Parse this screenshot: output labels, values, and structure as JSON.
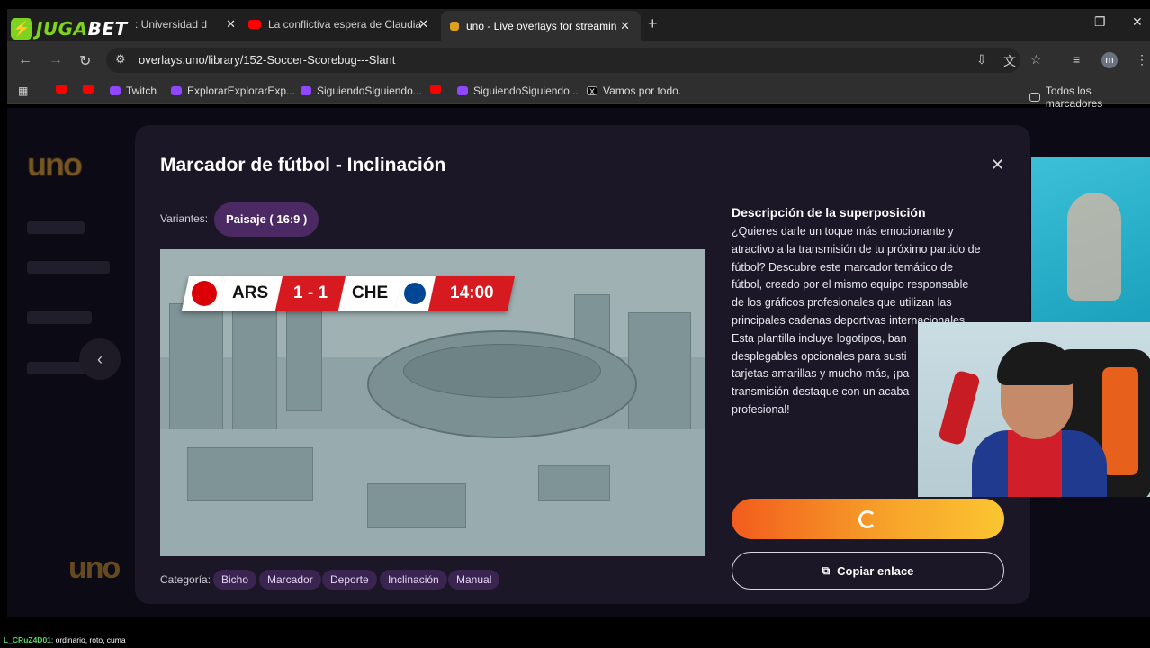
{
  "browser": {
    "logo": {
      "left": "JUGA",
      "right": "BET"
    },
    "tabs": [
      {
        "label": ": Universidad d",
        "icon": "tab-favicon"
      },
      {
        "label": "La conflictiva espera de Claudia",
        "icon": "youtube-icon"
      },
      {
        "label": "uno - Live overlays for streamin",
        "icon": "uno-icon",
        "active": true
      }
    ],
    "url": "overlays.uno/library/152-Soccer-Scorebug---Slant",
    "profile_initial": "m",
    "bookmarks": [
      {
        "label": "",
        "icon": "youtube-icon"
      },
      {
        "label": "",
        "icon": "youtube-icon"
      },
      {
        "label": "Twitch",
        "icon": "twitch-icon"
      },
      {
        "label": "ExplorarExplorarExp...",
        "icon": "twitch-icon"
      },
      {
        "label": "SiguiendoSiguiendo...",
        "icon": "twitch-icon"
      },
      {
        "label": "",
        "icon": "youtube-icon"
      },
      {
        "label": "SiguiendoSiguiendo...",
        "icon": "twitch-icon"
      },
      {
        "label": "Vamos por todo.",
        "icon": "x-icon"
      }
    ],
    "all_bookmarks": "Todos los marcadores"
  },
  "modal": {
    "title": "Marcador de fútbol - Inclinación",
    "variants_label": "Variantes:",
    "variant": "Paisaje ( 16:9 )",
    "scorebug": {
      "home": "ARS",
      "score": "1 - 1",
      "away": "CHE",
      "time": "14:00"
    },
    "description_title": "Descripción de la superposición",
    "description_lines": [
      "¿Quieres darle un toque más emocionante y",
      "atractivo a la transmisión de tu próximo partido de",
      "fútbol? Descubre este marcador temático de",
      "fútbol, creado por el mismo equipo responsable",
      "de los gráficos profesionales que utilizan las",
      "principales cadenas deportivas internacionales.",
      "Esta plantilla incluye logotipos, ban",
      "desplegables opcionales para susti",
      "tarjetas amarillas y mucho más, ¡pa",
      "transmisión destaque con un acaba",
      "profesional!"
    ],
    "copy_link": "Copiar enlace",
    "category_label": "Categoría:",
    "categories": [
      "Bicho",
      "Marcador",
      "Deporte",
      "Inclinación",
      "Manual"
    ]
  },
  "chat": {
    "user": "L_CRuZ4D01",
    "message": ": ordinario, roto, cuma"
  },
  "colors": {
    "accent_start": "#f25c1d",
    "accent_end": "#fbc531",
    "modal_bg": "#1b1727",
    "pill_bg": "#4b2a63"
  }
}
